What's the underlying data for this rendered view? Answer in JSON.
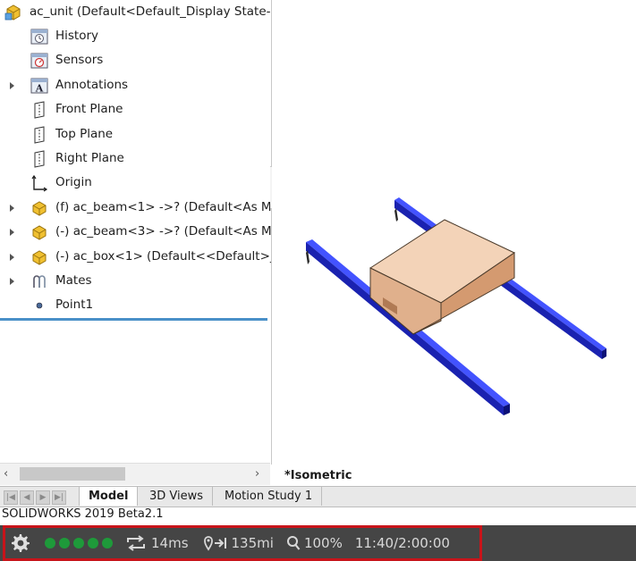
{
  "tree": {
    "root": {
      "label": "ac_unit  (Default<Default_Display State-1"
    },
    "items": [
      {
        "label": "History",
        "icon": "history-icon",
        "expandable": false
      },
      {
        "label": "Sensors",
        "icon": "sensors-icon",
        "expandable": false
      },
      {
        "label": "Annotations",
        "icon": "annotations-icon",
        "expandable": true
      },
      {
        "label": "Front Plane",
        "icon": "plane-icon",
        "expandable": false
      },
      {
        "label": "Top Plane",
        "icon": "plane-icon",
        "expandable": false
      },
      {
        "label": "Right Plane",
        "icon": "plane-icon",
        "expandable": false
      },
      {
        "label": "Origin",
        "icon": "origin-icon",
        "expandable": false
      },
      {
        "label": "(f) ac_beam<1> ->? (Default<As Ma",
        "icon": "part-icon",
        "expandable": true
      },
      {
        "label": "(-) ac_beam<3> ->? (Default<As Ma",
        "icon": "part-icon",
        "expandable": true
      },
      {
        "label": "(-) ac_box<1> (Default<<Default>_F",
        "icon": "part-icon",
        "expandable": true
      },
      {
        "label": "Mates",
        "icon": "mates-icon",
        "expandable": true
      },
      {
        "label": "Point1",
        "icon": "point-icon",
        "expandable": false
      }
    ]
  },
  "viewport": {
    "orientation_label": "*Isometric"
  },
  "tabs": [
    {
      "label": "Model",
      "active": true
    },
    {
      "label": "3D Views",
      "active": false
    },
    {
      "label": "Motion Study 1",
      "active": false
    }
  ],
  "status": {
    "app_version": "SOLIDWORKS 2019 Beta2.1"
  },
  "hud": {
    "dots_count": 5,
    "loop_time": "14ms",
    "distance": "135mi",
    "zoom": "100%",
    "time": "11:40/2:00:00"
  },
  "colors": {
    "beam": "#2233dd",
    "box": "#f3d3b8",
    "hud_highlight": "#c8141a",
    "dot": "#1e9a3a",
    "tree_accent": "#4a90c8"
  }
}
